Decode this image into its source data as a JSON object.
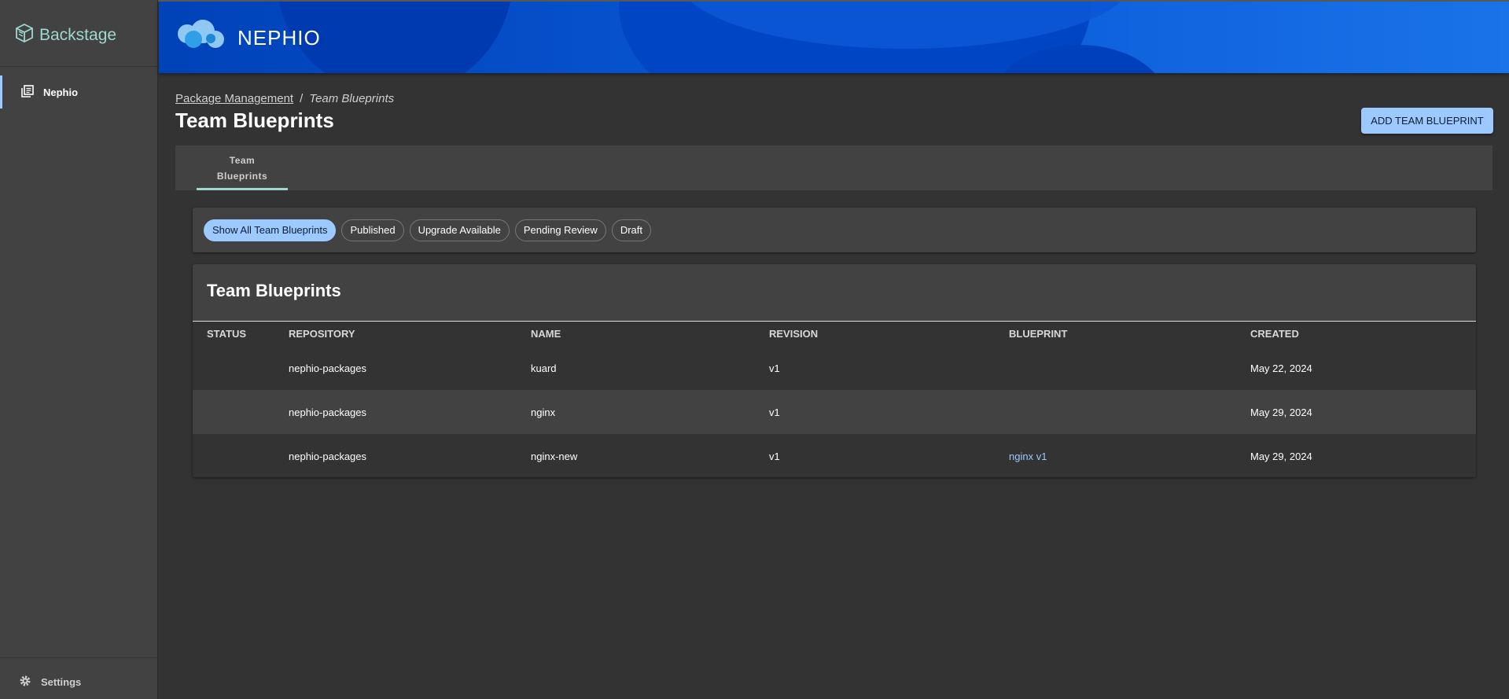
{
  "sidebar": {
    "app_name": "Backstage",
    "nav_item": "Nephio",
    "settings": "Settings"
  },
  "header": {
    "brand": "NEPHIO"
  },
  "breadcrumb": {
    "parent": "Package Management",
    "separator": "/",
    "current": "Team Blueprints"
  },
  "page": {
    "title": "Team Blueprints",
    "add_button": "ADD TEAM BLUEPRINT"
  },
  "tabs": [
    {
      "line1": "Team",
      "line2": "Blueprints"
    }
  ],
  "filters": [
    {
      "label": "Show All Team Blueprints",
      "active": true
    },
    {
      "label": "Published"
    },
    {
      "label": "Upgrade Available"
    },
    {
      "label": "Pending Review"
    },
    {
      "label": "Draft"
    }
  ],
  "table": {
    "title": "Team Blueprints",
    "columns": [
      "STATUS",
      "REPOSITORY",
      "NAME",
      "REVISION",
      "BLUEPRINT",
      "CREATED"
    ],
    "rows": [
      {
        "status": "",
        "repository": "nephio-packages",
        "name": "kuard",
        "revision": "v1",
        "blueprint": "",
        "created": "May 22, 2024"
      },
      {
        "status": "",
        "repository": "nephio-packages",
        "name": "nginx",
        "revision": "v1",
        "blueprint": "",
        "created": "May 29, 2024"
      },
      {
        "status": "",
        "repository": "nephio-packages",
        "name": "nginx-new",
        "revision": "v1",
        "blueprint": "nginx v1",
        "created": "May 29, 2024"
      }
    ]
  },
  "colors": {
    "accent": "#9cc9ff",
    "teal": "#9ed8d0",
    "header_blue": "#0a5ad8",
    "background": "#333333",
    "panel": "#424242"
  }
}
